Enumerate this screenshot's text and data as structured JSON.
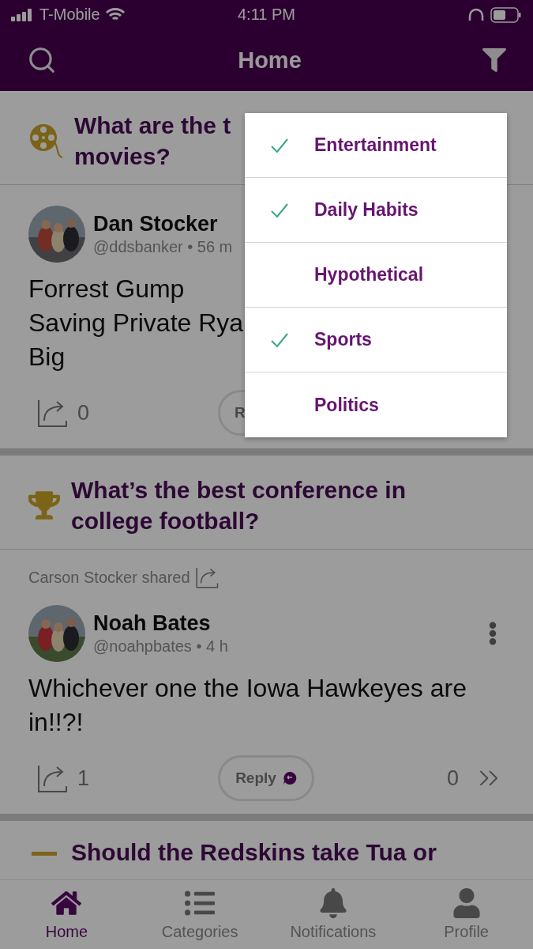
{
  "status_bar": {
    "carrier": "T-Mobile",
    "time": "4:11 PM"
  },
  "header": {
    "title": "Home"
  },
  "posts": [
    {
      "kind": "film",
      "question": "What are the t movies?",
      "author": "Dan Stocker",
      "meta": "@ddsbanker • 56 m",
      "body": [
        "Forrest Gump",
        "Saving Private Rya",
        "Big"
      ],
      "share_count": "0",
      "reply_label": "R"
    },
    {
      "kind": "trophy",
      "question": "What’s the best conference in college football?",
      "shared_by": "Carson Stocker shared",
      "author": "Noah Bates",
      "meta": "@noahpbates • 4 h",
      "body": [
        "Whichever one the Iowa Hawkeyes are in!!?!"
      ],
      "share_count": "1",
      "reply_label": "Reply",
      "reply_count": "0"
    },
    {
      "kind": "partial",
      "question": "Should the Redskins take Tua or"
    }
  ],
  "filter_menu": {
    "items": [
      {
        "label": "Entertainment",
        "checked": true
      },
      {
        "label": "Daily Habits",
        "checked": true
      },
      {
        "label": "Hypothetical",
        "checked": false
      },
      {
        "label": "Sports",
        "checked": true
      },
      {
        "label": "Politics",
        "checked": false
      }
    ]
  },
  "tab_bar": {
    "tabs": [
      {
        "label": "Home",
        "selected": true
      },
      {
        "label": "Categories",
        "selected": false
      },
      {
        "label": "Notifications",
        "selected": false
      },
      {
        "label": "Profile",
        "selected": false
      }
    ]
  }
}
